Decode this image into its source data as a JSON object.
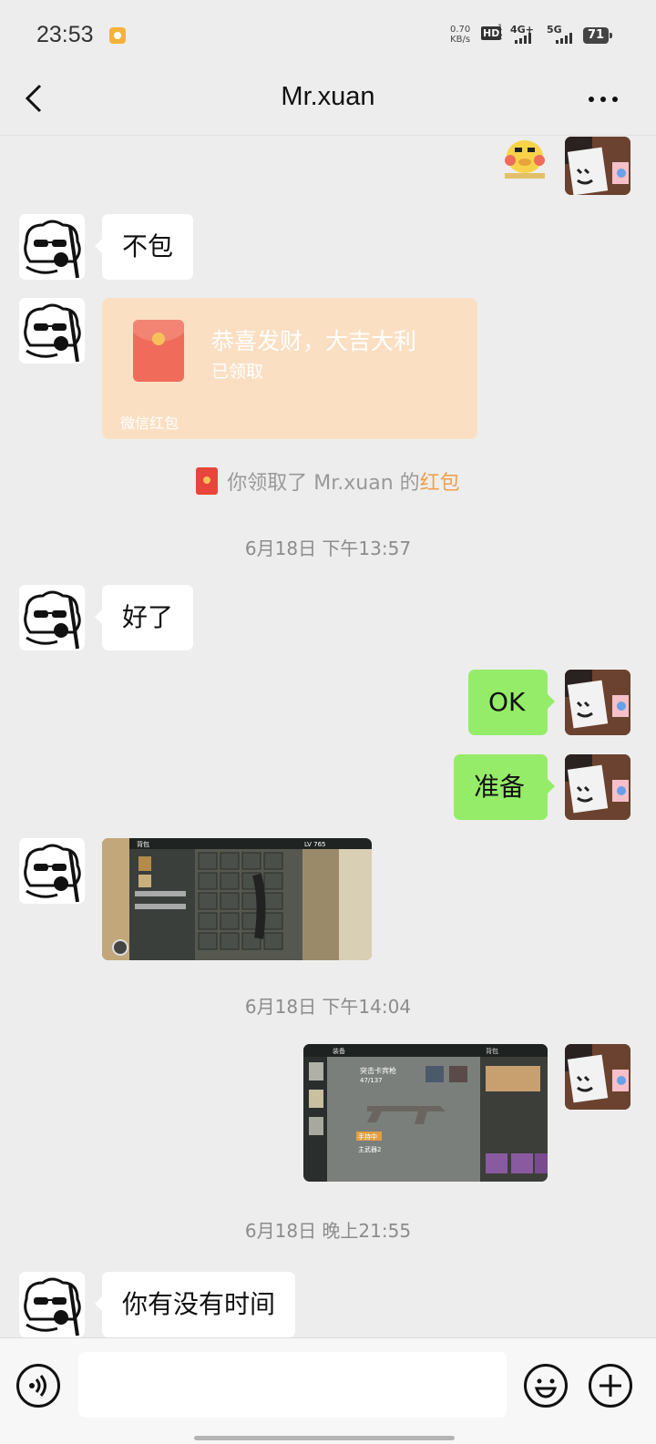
{
  "status_bar": {
    "time": "23:53",
    "net_speed_value": "0.70",
    "net_speed_unit": "KB/s",
    "hd_label": "HD",
    "hd_sub_top": "1",
    "hd_sub_bottom": "2",
    "network_1": "4G+",
    "network_2": "5G",
    "battery": "71"
  },
  "header": {
    "title": "Mr.xuan"
  },
  "messages": {
    "m1_text": "不包",
    "red_packet": {
      "title": "恭喜发财，大吉大利",
      "status": "已领取",
      "footer": "微信红包"
    },
    "system_text": "你领取了 Mr.xuan 的",
    "system_link": "红包",
    "ts1": "6月18日 下午13:57",
    "m2_text": "好了",
    "m3_text": "OK",
    "m4_text": "准备",
    "ts2": "6月18日 下午14:04",
    "ts3": "6月18日 晚上21:55",
    "m5_text": "你有没有时间"
  },
  "screenshot_labels": {
    "title_1": "背包",
    "status_1": "LV 765",
    "title_2": "装备",
    "weapon_name": "突击卡宾枪",
    "ammo": "47/137",
    "equipped": "手持中",
    "weapon_slot": "主武器2",
    "backpack": "背包"
  },
  "input": {
    "placeholder": ""
  }
}
